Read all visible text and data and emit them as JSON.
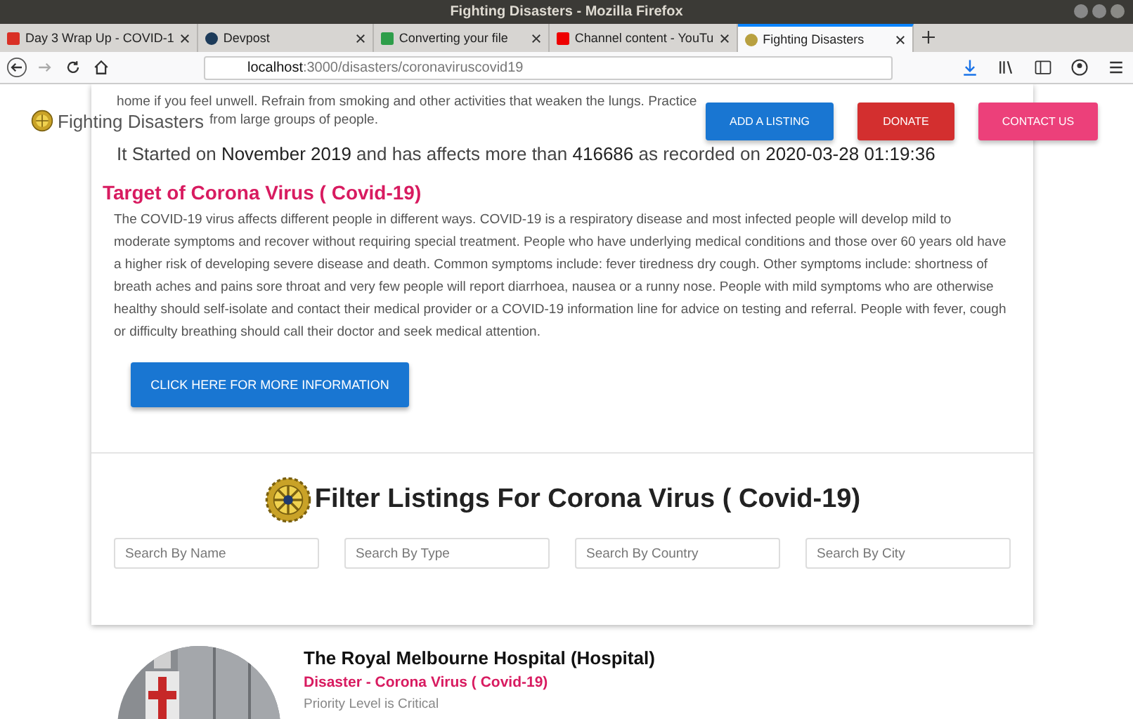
{
  "window": {
    "title": "Fighting Disasters - Mozilla Firefox"
  },
  "tabs": [
    {
      "label": "Day 3 Wrap Up - COVID-1",
      "kind": "mail",
      "selected": false
    },
    {
      "label": "Devpost",
      "kind": "devpost",
      "selected": false
    },
    {
      "label": "Converting your file",
      "kind": "convert",
      "selected": false
    },
    {
      "label": "Channel content - YouTu",
      "kind": "video",
      "selected": false
    },
    {
      "label": "Fighting Disasters",
      "kind": "site",
      "selected": true
    }
  ],
  "address": {
    "host": "localhost",
    "path": ":3000/disasters/coronaviruscovid19"
  },
  "navbar": {
    "brand": "Fighting Disasters",
    "buttons": [
      {
        "label": "ADD A LISTING",
        "color": "#1976d2"
      },
      {
        "label": "DONATE",
        "color": "#d32f2f"
      },
      {
        "label": "CONTACT US",
        "color": "#ec407a"
      }
    ]
  },
  "intro": [
    "home if you feel unwell. Refrain from smoking and other activities that weaken the lungs. Practice",
    "from large groups of people."
  ],
  "stats": "It Started on **November 2019** and has affects more than **416686** as recorded on **2020-03-28 01:19:36**",
  "target": {
    "heading": "Target of Corona Virus ( Covid-19)",
    "body": "The COVID-19 virus affects different people in different ways. COVID-19 is a respiratory disease and most infected people will develop mild to moderate symptoms and recover without requiring special treatment. People who have underlying medical conditions and those over 60 years old have a higher risk of developing severe disease and death. Common symptoms include: fever tiredness dry cough. Other symptoms include: shortness of breath aches and pains sore throat and very few people will report diarrhoea, nausea or a runny nose. People with mild symptoms who are otherwise healthy should self-isolate and contact their medical provider or a COVID-19 information line for advice on testing and referral. People with fever, cough or difficulty breathing should call their doctor and seek medical attention.",
    "button": "CLICK HERE FOR MORE INFORMATION"
  },
  "filter": {
    "heading": "Filter Listings For Corona Virus ( Covid-19)",
    "fields": [
      {
        "placeholder": "Search By Name"
      },
      {
        "placeholder": "Search By Type"
      },
      {
        "placeholder": "Search By Country"
      },
      {
        "placeholder": "Search By City"
      }
    ]
  },
  "listing": {
    "title": "The Royal Melbourne Hospital (Hospital)",
    "disaster": "Disaster - Corona Virus ( Covid-19)",
    "priority": "Priority Level is Critical"
  }
}
